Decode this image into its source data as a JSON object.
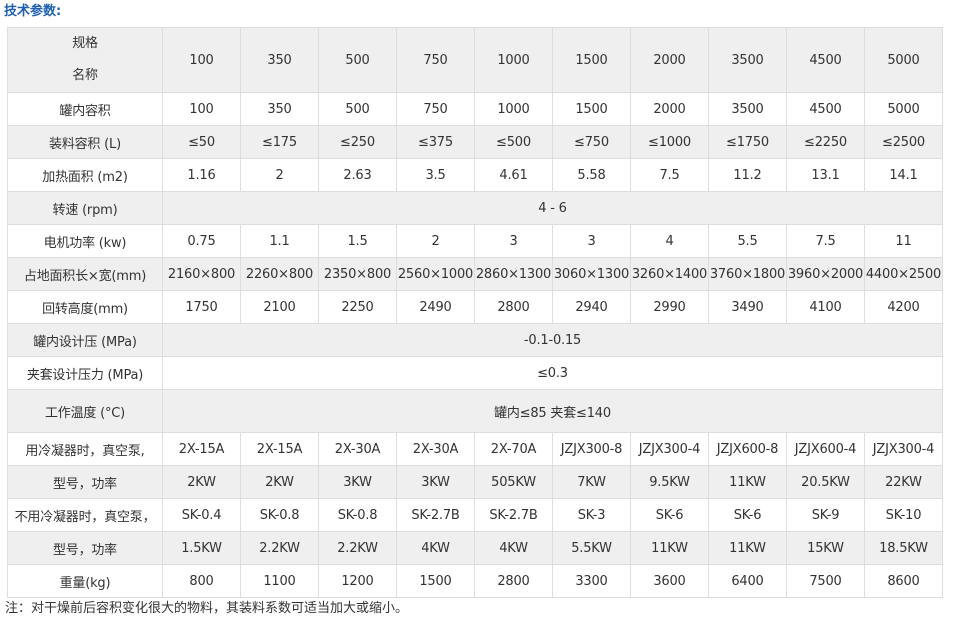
{
  "heading": "技术参数:",
  "header": {
    "corner_top": "规格",
    "corner_bottom": "名称",
    "models": [
      "100",
      "350",
      "500",
      "750",
      "1000",
      "1500",
      "2000",
      "3500",
      "4500",
      "5000"
    ]
  },
  "rows": [
    {
      "label": "罐内容积",
      "values": [
        "100",
        "350",
        "500",
        "750",
        "1000",
        "1500",
        "2000",
        "3500",
        "4500",
        "5000"
      ]
    },
    {
      "label": "装料容积 (L)",
      "values": [
        "≤50",
        "≤175",
        "≤250",
        "≤375",
        "≤500",
        "≤750",
        "≤1000",
        "≤1750",
        "≤2250",
        "≤2500"
      ]
    },
    {
      "label": "加热面积 (m2)",
      "values": [
        "1.16",
        "2",
        "2.63",
        "3.5",
        "4.61",
        "5.58",
        "7.5",
        "11.2",
        "13.1",
        "14.1"
      ]
    },
    {
      "label": "转速 (rpm)",
      "merged": "4 - 6"
    },
    {
      "label": "电机功率 (kw)",
      "values": [
        "0.75",
        "1.1",
        "1.5",
        "2",
        "3",
        "3",
        "4",
        "5.5",
        "7.5",
        "11"
      ]
    },
    {
      "label": "占地面积长×宽(mm)",
      "values": [
        "2160×800",
        "2260×800",
        "2350×800",
        "2560×1000",
        "2860×1300",
        "3060×1300",
        "3260×1400",
        "3760×1800",
        "3960×2000",
        "4400×2500"
      ]
    },
    {
      "label": "回转高度(mm)",
      "values": [
        "1750",
        "2100",
        "2250",
        "2490",
        "2800",
        "2940",
        "2990",
        "3490",
        "4100",
        "4200"
      ]
    },
    {
      "label": "罐内设计压 (MPa)",
      "merged": "-0.1-0.15"
    },
    {
      "label": "夹套设计压力 (MPa)",
      "merged": "≤0.3"
    },
    {
      "label": "工作温度 (°C)",
      "merged": "罐内≤85 夹套≤140"
    },
    {
      "label": "用冷凝器时，真空泵,",
      "values": [
        "2X-15A",
        "2X-15A",
        "2X-30A",
        "2X-30A",
        "2X-70A",
        "JZJX300-8",
        "JZJX300-4",
        "JZJX600-8",
        "JZJX600-4",
        "JZJX300-4"
      ]
    },
    {
      "label": "型号，功率",
      "values": [
        "2KW",
        "2KW",
        "3KW",
        "3KW",
        "505KW",
        "7KW",
        "9.5KW",
        "11KW",
        "20.5KW",
        "22KW"
      ]
    },
    {
      "label": "不用冷凝器时，真空泵，",
      "values": [
        "SK-0.4",
        "SK-0.8",
        "SK-0.8",
        "SK-2.7B",
        "SK-2.7B",
        "SK-3",
        "SK-6",
        "SK-6",
        "SK-9",
        "SK-10"
      ]
    },
    {
      "label": "型号，功率",
      "values": [
        "1.5KW",
        "2.2KW",
        "2.2KW",
        "4KW",
        "4KW",
        "5.5KW",
        "11KW",
        "11KW",
        "15KW",
        "18.5KW"
      ]
    },
    {
      "label": "重量(kg)",
      "values": [
        "800",
        "1100",
        "1200",
        "1500",
        "2800",
        "3300",
        "3600",
        "6400",
        "7500",
        "8600"
      ]
    }
  ],
  "footnote": "注：对干燥前后容积变化很大的物料，其装料系数可适当加大或缩小。"
}
